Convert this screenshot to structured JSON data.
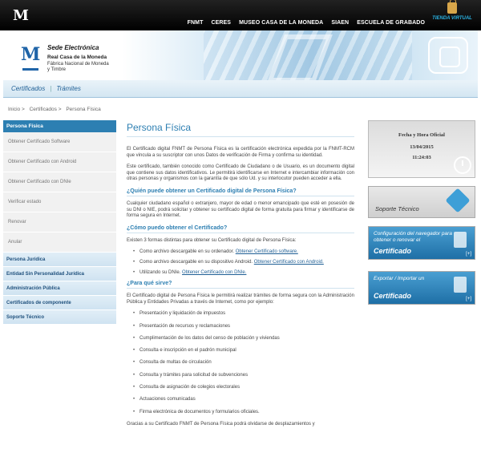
{
  "header": {
    "nav": [
      "FNMT",
      "CERES",
      "MUSEO CASA DE LA MONEDA",
      "SIAEN",
      "ESCUELA DE GRABADO"
    ],
    "store": "TIENDA VIRTUAL"
  },
  "banner": {
    "title": "Sede Electrónica",
    "org_line1": "Real Casa de la Moneda",
    "org_line2": "Fábrica Nacional de Moneda y Timbre"
  },
  "subnav": {
    "items": [
      "Certificados",
      "Trámites"
    ]
  },
  "breadcrumb": [
    "Inicio >",
    "Certificados >",
    "Persona Física"
  ],
  "sidebar": {
    "active": "Persona Física",
    "subitems": [
      "Obtener Certificado Software",
      "Obtener Certificado con Android",
      "Obtener Certificado con DNIe",
      "Verificar estado",
      "Renovar",
      "Anular"
    ],
    "sections": [
      "Persona Jurídica",
      "Entidad Sin Personalidad Jurídica",
      "Administración Pública",
      "Certificados de componente",
      "Soporte Técnico"
    ]
  },
  "main": {
    "title": "Persona Física",
    "p1": "El Certificado digital FNMT de Persona Física es la certificación electrónica expedida por la FNMT-RCM que vincula a su suscriptor con unos Datos de verificación de Firma y confirma su identidad.",
    "p2": "Este certificado, también conocido como Certificado de Ciudadano o de Usuario, es un documento digital que contiene sus datos identificativos. Le permitirá identificarse en Internet e intercambiar información con otras personas y organismos con la garantía de que sólo Ud. y su interlocutor pueden acceder a ella.",
    "h_quien": "¿Quién puede obtener un Certificado digital de Persona Física?",
    "p_quien": "Cualquier ciudadano español o extranjero, mayor de edad o menor emancipado que esté en posesión de su DNI o NIE, podrá solicitar y obtener su certificado digital de forma gratuita para firmar y identificarse de forma segura en Internet.",
    "h_como": "¿Cómo puedo obtener el Certificado?",
    "p_como": "Existen 3 formas distintas para obtener su Certificado digital de Persona Física:",
    "ways": [
      {
        "text": "Como archivo descargable en su ordenador.",
        "link": "Obtener Certificado software."
      },
      {
        "text": "Como archivo descargable en su dispositivo Android.",
        "link": "Obtener Certificado con Android."
      },
      {
        "text": "Utilizando su DNIe.",
        "link": "Obtener Certificado con DNIe."
      }
    ],
    "h_para": "¿Para qué sirve?",
    "p_para": "El Certificado digital de Persona Física le permitirá realizar trámites de forma segura con la Administración Pública y Entidades Privadas a través de Internet, como por ejemplo:",
    "uses": [
      "Presentación y liquidación de impuestos",
      "Presentación de recursos y reclamaciones",
      "Cumplimentación de los datos del censo de población y viviendas",
      "Consulta e inscripción en el padrón municipal",
      "Consulta de multas de circulación",
      "Consulta y trámites para solicitud de subvenciones",
      "Consulta de asignación de colegios electorales",
      "Actuaciones comunicadas",
      "Firma electrónica de documentos y formularios oficiales."
    ],
    "p_final": "Gracias a su Certificado FNMT de Persona Física podrá olvidarse de desplazamientos y"
  },
  "right": {
    "clock_title": "Fecha y Hora Oficial",
    "date": "13/04/2015",
    "time": "11:24:03",
    "support": "Soporte Técnico",
    "config_l1": "Configuración del navegador para obtener o renovar el",
    "config_l2": "Certificado",
    "export_l1": "Exportar / Importar un",
    "export_l2": "Certificado",
    "plus": "[+]"
  }
}
